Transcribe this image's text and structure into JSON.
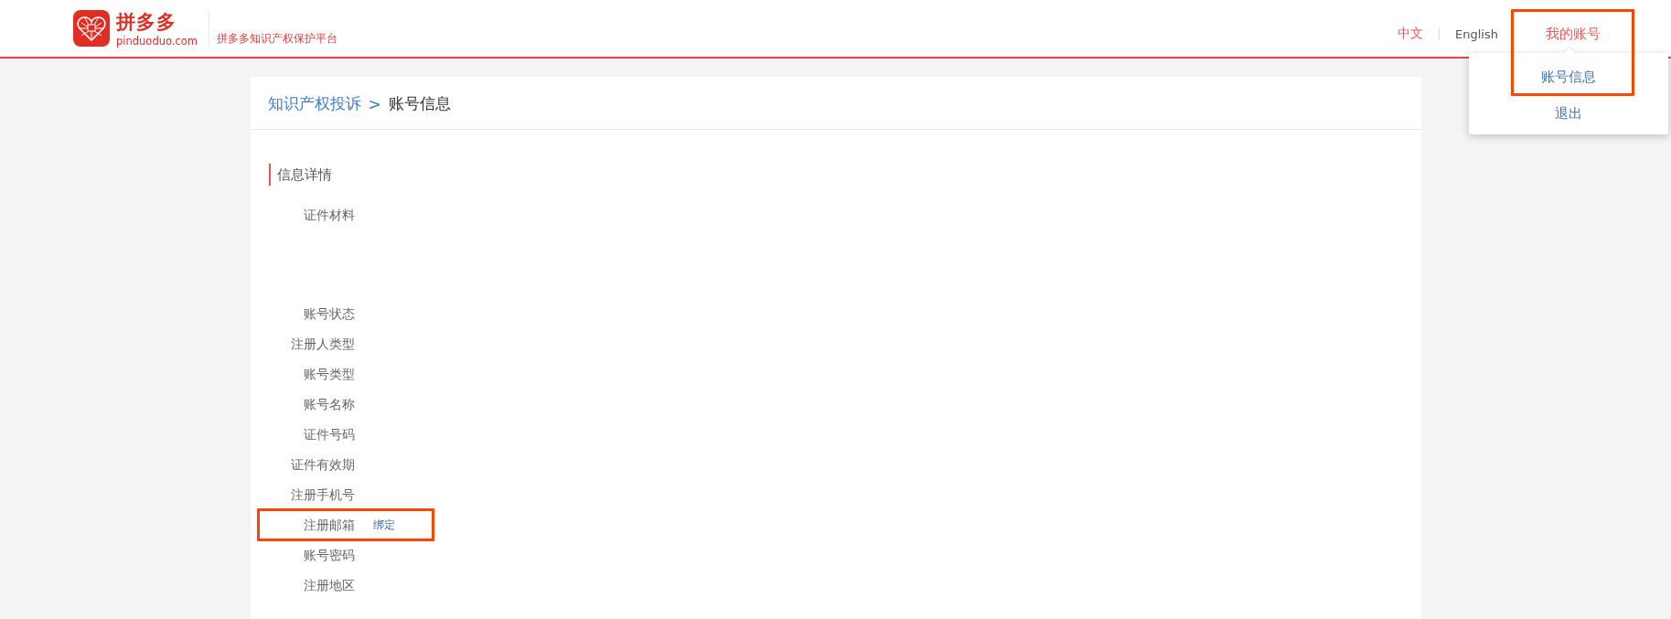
{
  "header": {
    "brand": {
      "name": "拼多多",
      "domain": "pinduoduo.com"
    },
    "platform_title": "拼多多知识产权保护平台",
    "languages": [
      {
        "label": "中文",
        "selected": true
      },
      {
        "label": "English",
        "selected": false
      }
    ],
    "account_menu": {
      "label": "我的账号",
      "expanded": true,
      "highlighted": true,
      "items": [
        {
          "label": "账号信息"
        },
        {
          "label": "退出"
        }
      ]
    }
  },
  "breadcrumb": {
    "items": [
      {
        "label": "知识产权投诉",
        "kind": "link"
      },
      {
        "label": "账号信息",
        "kind": "current"
      }
    ],
    "separator": ">"
  },
  "info": {
    "title": "信息详情",
    "fields": [
      {
        "label": "证件材料",
        "kind": "attachment",
        "highlighted": false
      },
      {
        "label": "账号状态",
        "kind": "text",
        "highlighted": false
      },
      {
        "label": "注册人类型",
        "kind": "text",
        "highlighted": false
      },
      {
        "label": "账号类型",
        "kind": "text",
        "highlighted": false
      },
      {
        "label": "账号名称",
        "kind": "text",
        "highlighted": false
      },
      {
        "label": "证件号码",
        "kind": "text",
        "highlighted": false
      },
      {
        "label": "证件有效期",
        "kind": "text",
        "highlighted": false
      },
      {
        "label": "注册手机号",
        "kind": "text",
        "highlighted": false
      },
      {
        "label": "注册邮箱",
        "kind": "text",
        "highlighted": true,
        "action": "绑定"
      },
      {
        "label": "账号密码",
        "kind": "text",
        "highlighted": false
      },
      {
        "label": "注册地区",
        "kind": "text",
        "highlighted": false
      }
    ]
  }
}
